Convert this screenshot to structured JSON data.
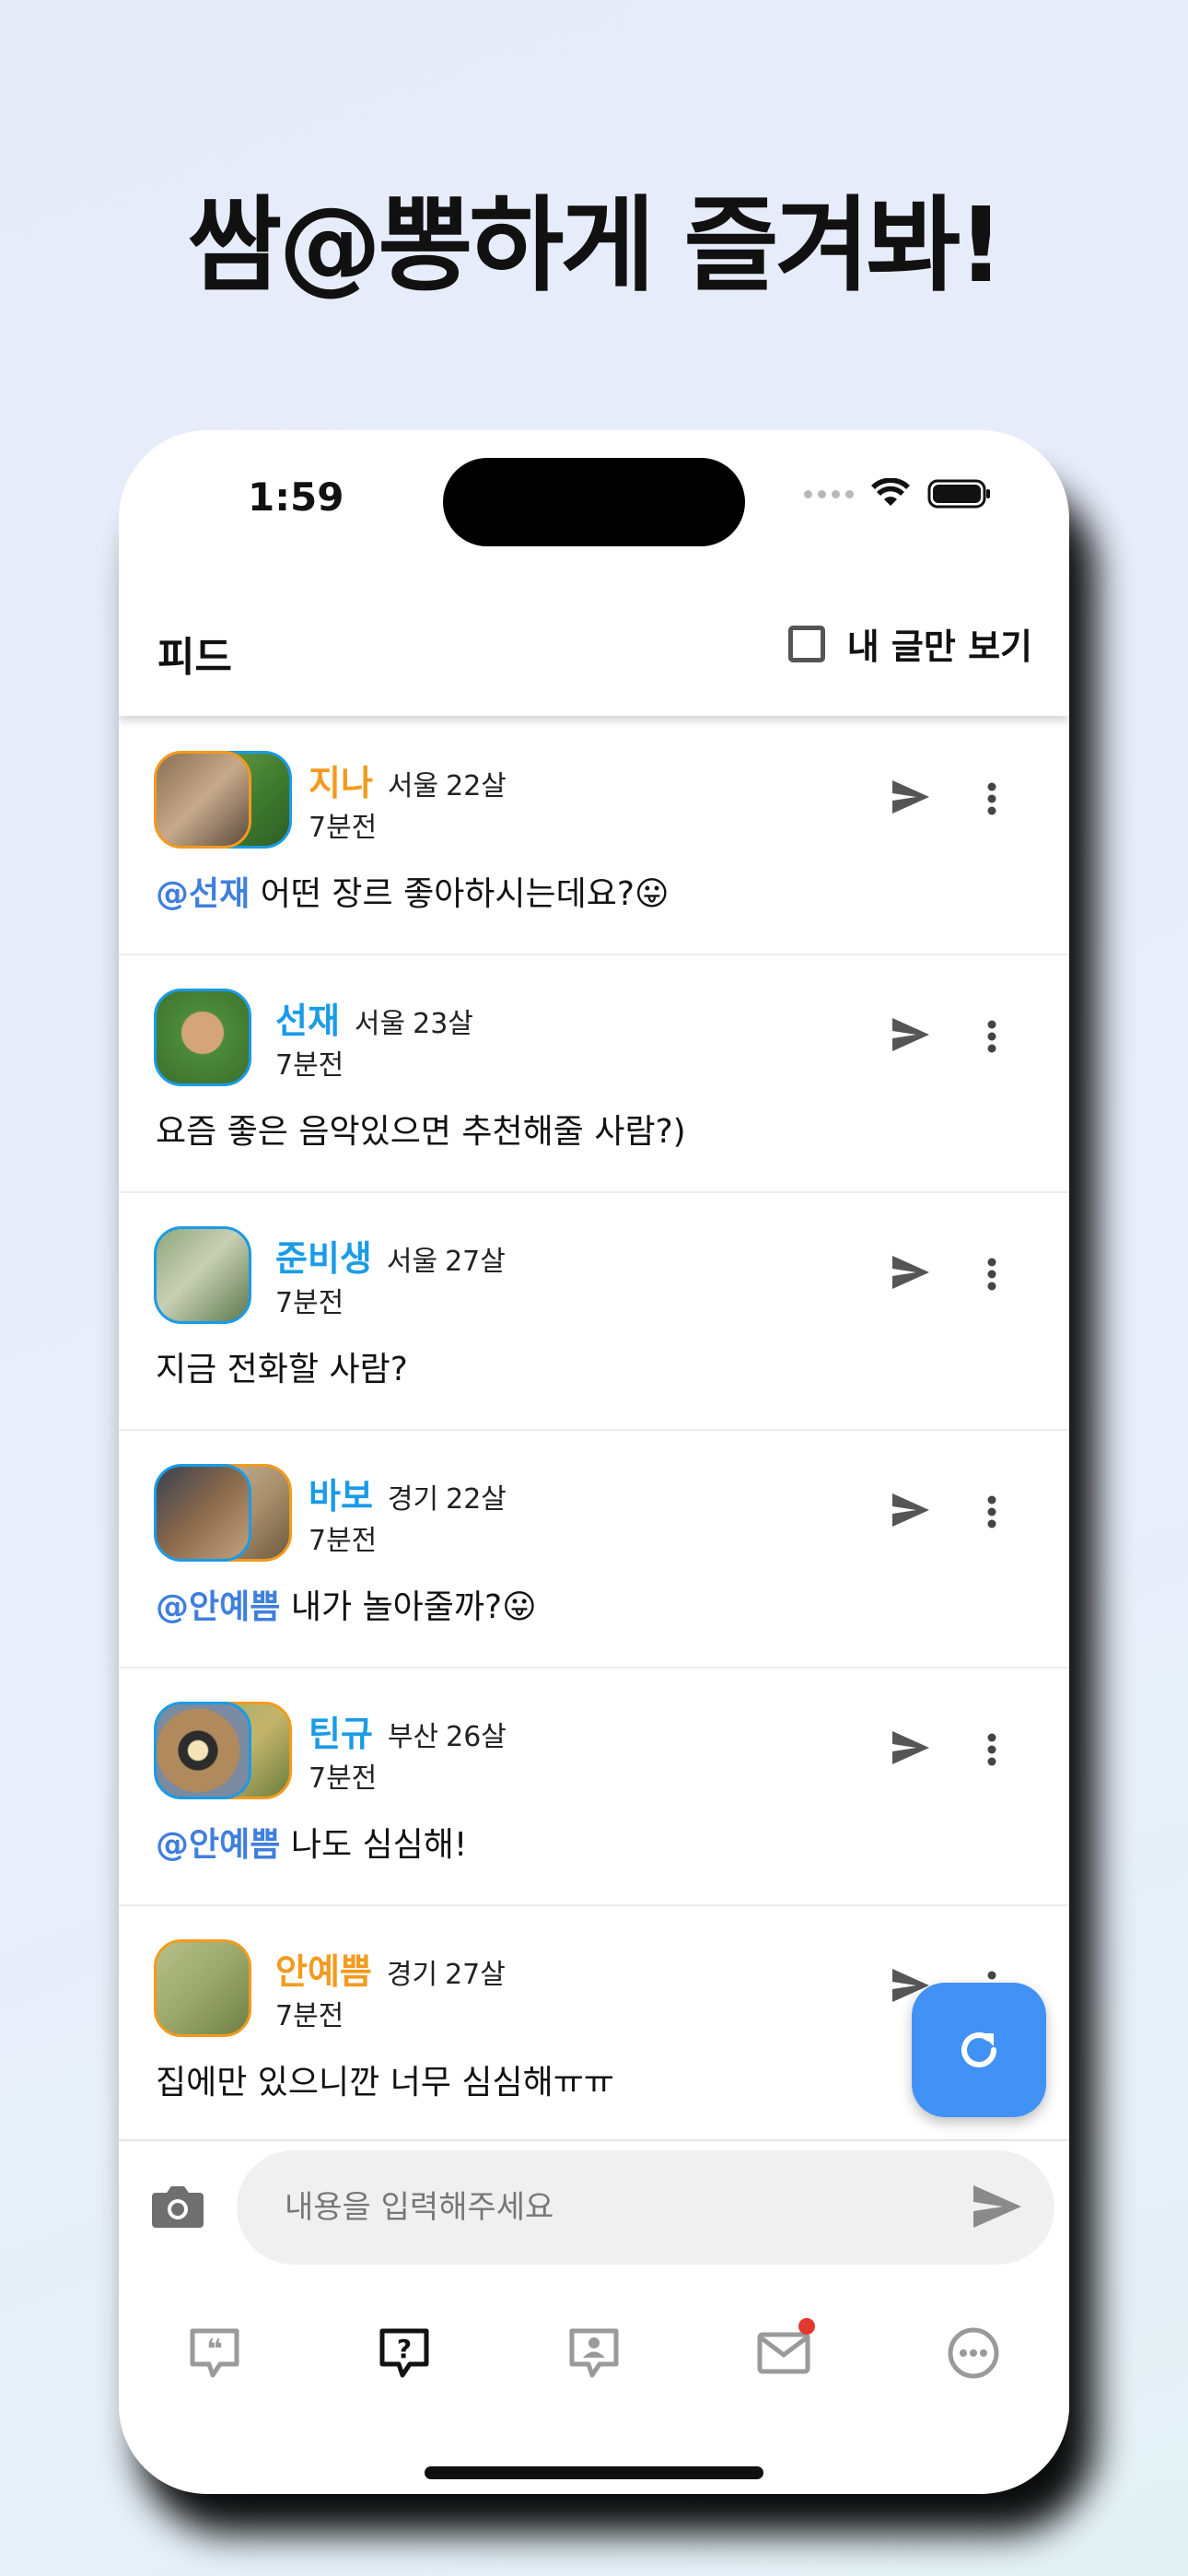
{
  "promo": {
    "headline": "쌈@뽕하게  즐겨봐!"
  },
  "status_bar": {
    "time": "1:59"
  },
  "header": {
    "title": "피드",
    "my_posts_only_label": "내 글만 보기",
    "my_posts_only_checked": false
  },
  "posts": [
    {
      "nickname": "지나",
      "nick_color": "#f39a1e",
      "region": "서울",
      "age": "22살",
      "time": "7분전",
      "mention": "@선재",
      "text": "어떤 장르 좋아하시는데요?😛"
    },
    {
      "nickname": "선재",
      "nick_color": "#1a9be6",
      "region": "서울",
      "age": "23살",
      "time": "7분전",
      "mention": "",
      "text": "요즘 좋은 음악있으면 추천해줄 사람?)"
    },
    {
      "nickname": "준비생",
      "nick_color": "#1a9be6",
      "region": "서울",
      "age": "27살",
      "time": "7분전",
      "mention": "",
      "text": "지금 전화할 사람?"
    },
    {
      "nickname": "바보",
      "nick_color": "#1a9be6",
      "region": "경기",
      "age": "22살",
      "time": "7분전",
      "mention": "@안예쁨",
      "text": "내가 놀아줄까?😛"
    },
    {
      "nickname": "틴규",
      "nick_color": "#1a9be6",
      "region": "부산",
      "age": "26살",
      "time": "7분전",
      "mention": "@안예쁨",
      "text": "나도 심심해!"
    },
    {
      "nickname": "안예쁨",
      "nick_color": "#f39a1e",
      "region": "경기",
      "age": "27살",
      "time": "7분전",
      "mention": "",
      "text": "집에만 있으니깐 너무 심심해ㅠㅠ"
    }
  ],
  "composer": {
    "placeholder": "내용을 입력해주세요"
  },
  "tabs": [
    {
      "icon": "quote-bubble-icon",
      "active": false
    },
    {
      "icon": "question-bubble-icon",
      "active": true
    },
    {
      "icon": "profile-bubble-icon",
      "active": false
    },
    {
      "icon": "mail-icon",
      "active": false,
      "has_badge": true
    },
    {
      "icon": "more-circle-icon",
      "active": false
    }
  ],
  "colors": {
    "fab": "#4292f6",
    "mention": "#3f7fdd",
    "badge": "#e5392f",
    "orange_nick": "#f39a1e",
    "blue_nick": "#1a9be6"
  }
}
